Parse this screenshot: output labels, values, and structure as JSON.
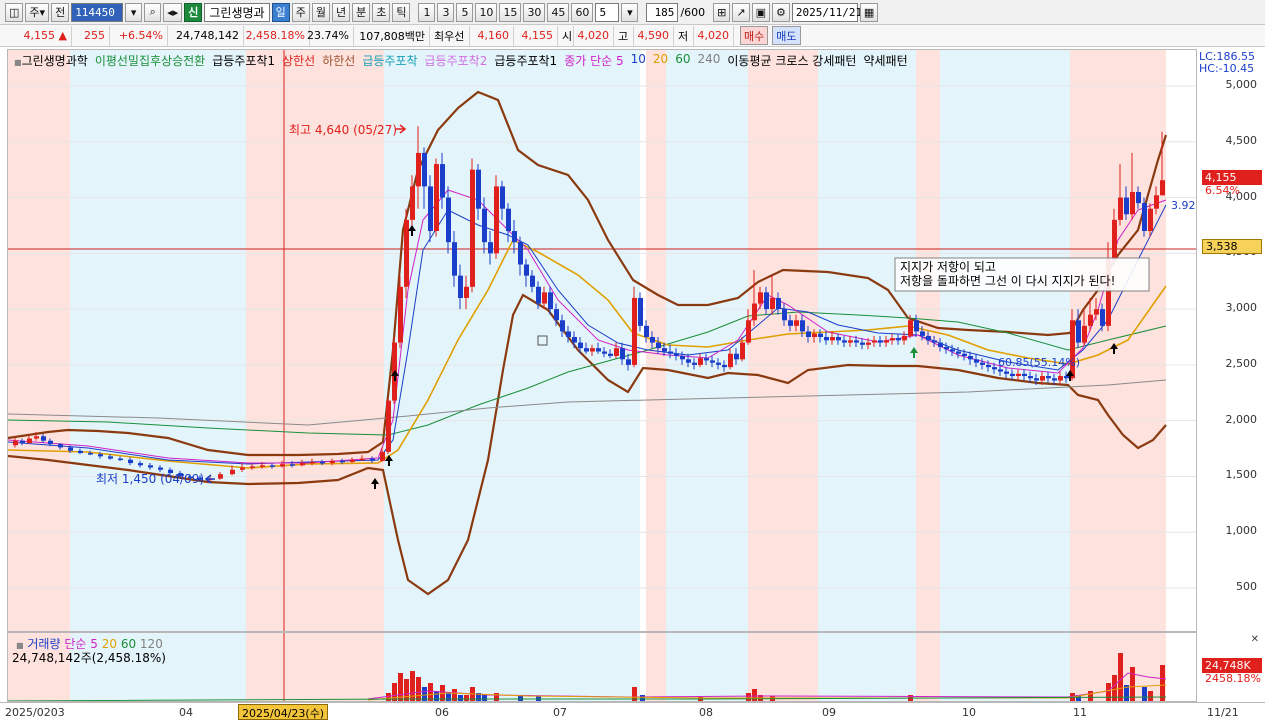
{
  "toolbar": {
    "mode_label": "주",
    "view_label": "전",
    "code": "114450",
    "new_label": "신",
    "stock_name": "그린생명과",
    "periods": [
      "일",
      "주",
      "월",
      "년",
      "분",
      "초",
      "틱"
    ],
    "active_period": "일",
    "intervals": [
      "1",
      "3",
      "5",
      "10",
      "15",
      "30",
      "45",
      "60"
    ],
    "interval_value": "5",
    "count": "185",
    "count_max": "/600",
    "date": "2025/11/21"
  },
  "quote": {
    "price": "4,155",
    "arrow": "▲",
    "change": "255",
    "change_pct": "+6.54%",
    "volume": "24,748,142",
    "volume_pct": "2,458.18%",
    "turnover": "23.74%",
    "amount": "107,808백만",
    "best_label": "최우선",
    "best_sell": "4,160",
    "best_buy": "4,155",
    "open_label": "시",
    "open": "4,020",
    "high_label": "고",
    "high": "4,590",
    "low_label": "저",
    "low": "4,020",
    "buy_button": "매수",
    "sell_button": "매도"
  },
  "legend": {
    "stock": "그린생명과학",
    "items": [
      {
        "text": "이평선밀집후상승전환",
        "color": "#1a8f3a"
      },
      {
        "text": "급등주포착1",
        "color": "#000000"
      },
      {
        "text": "상한선",
        "color": "#e0201c"
      },
      {
        "text": "하한선",
        "color": "#a0522d"
      },
      {
        "text": "급등주포착",
        "color": "#18a0b8"
      },
      {
        "text": "급등주포착2",
        "color": "#d06fe0"
      },
      {
        "text": "급등주포착1",
        "color": "#000000"
      },
      {
        "text": "종가 단순 5",
        "color": "#d021c8"
      },
      {
        "text": "10",
        "color": "#1a3ec9"
      },
      {
        "text": "20",
        "color": "#e0a000"
      },
      {
        "text": "60",
        "color": "#1a8f3a"
      },
      {
        "text": "240",
        "color": "#808080"
      },
      {
        "text": "이동평균 크로스 강세패턴",
        "color": "#000000"
      },
      {
        "text": "약세패턴",
        "color": "#000000"
      }
    ]
  },
  "annotations": {
    "high": "최고 4,640 (05/27)",
    "low": "최저 1,450 (04/09)",
    "fib": "60.85(55.14%)",
    "note_line1": "지지가 저항이 되고",
    "note_line2": "저항을 돌파하면 그선 이 다시 지지가 된다!",
    "ma_value": "3.92"
  },
  "price_axis": {
    "lc": "LC:186.55",
    "hc": "HC:-10.45",
    "ticks": [
      "5,000",
      "4,500",
      "4,000",
      "3,500",
      "3,000",
      "2,500",
      "2,000",
      "1,500",
      "1,000",
      "500"
    ],
    "last_price": "4,155",
    "last_pct": "6.54%",
    "cross_price": "3,538"
  },
  "volume_pane": {
    "legend_prefix": "거래량",
    "legend_ma": "단순 5",
    "ma_values": [
      "20",
      "60",
      "120"
    ],
    "info": "24,748,142주(2,458.18%)",
    "last_vol": "24,748K",
    "last_pct": "2458.18%"
  },
  "date_axis": {
    "labels": [
      "2025/0203",
      "04",
      "06",
      "07",
      "08",
      "09",
      "10",
      "11",
      "11/21"
    ],
    "cursor": "2025/04/23(수)"
  },
  "colors": {
    "up": "#e0201c",
    "down": "#1a3ec9",
    "band_pink": "#fde2dd",
    "band_blue": "#e3f4fa",
    "bollinger": "#8b3a10"
  },
  "chart_data": {
    "type": "candlestick",
    "ylim": [
      0,
      5000
    ],
    "series": [
      {
        "name": "고점",
        "values": [
          4640
        ]
      },
      {
        "name": "저점",
        "values": [
          1450
        ]
      }
    ]
  }
}
